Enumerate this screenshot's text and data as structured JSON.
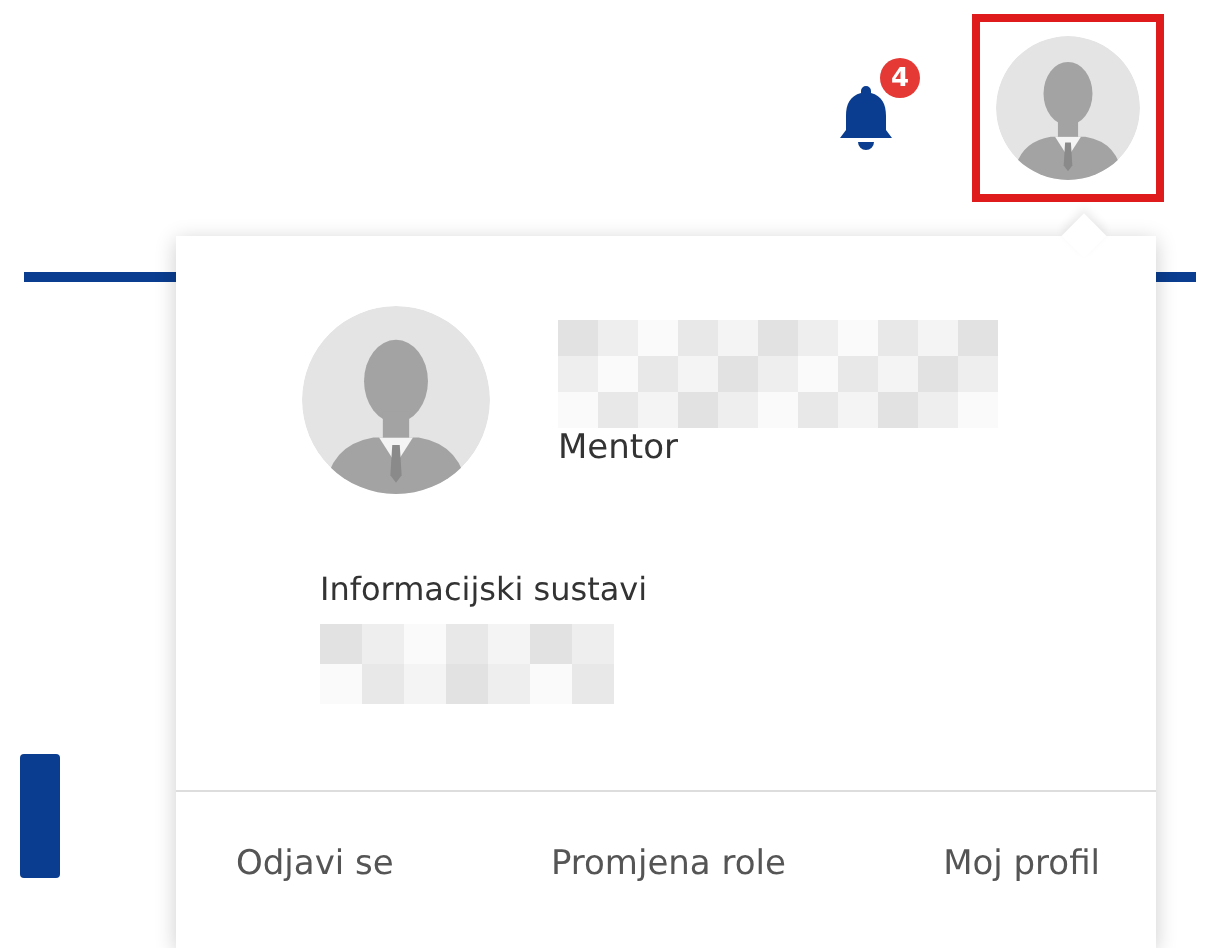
{
  "notifications": {
    "count": "4"
  },
  "user_button": {
    "highlighted": true
  },
  "profile": {
    "role": "Mentor",
    "department": "Informacijski sustavi"
  },
  "actions": [
    {
      "label": "Odjavi se"
    },
    {
      "label": "Promjena role"
    },
    {
      "label": "Moj profil"
    }
  ]
}
